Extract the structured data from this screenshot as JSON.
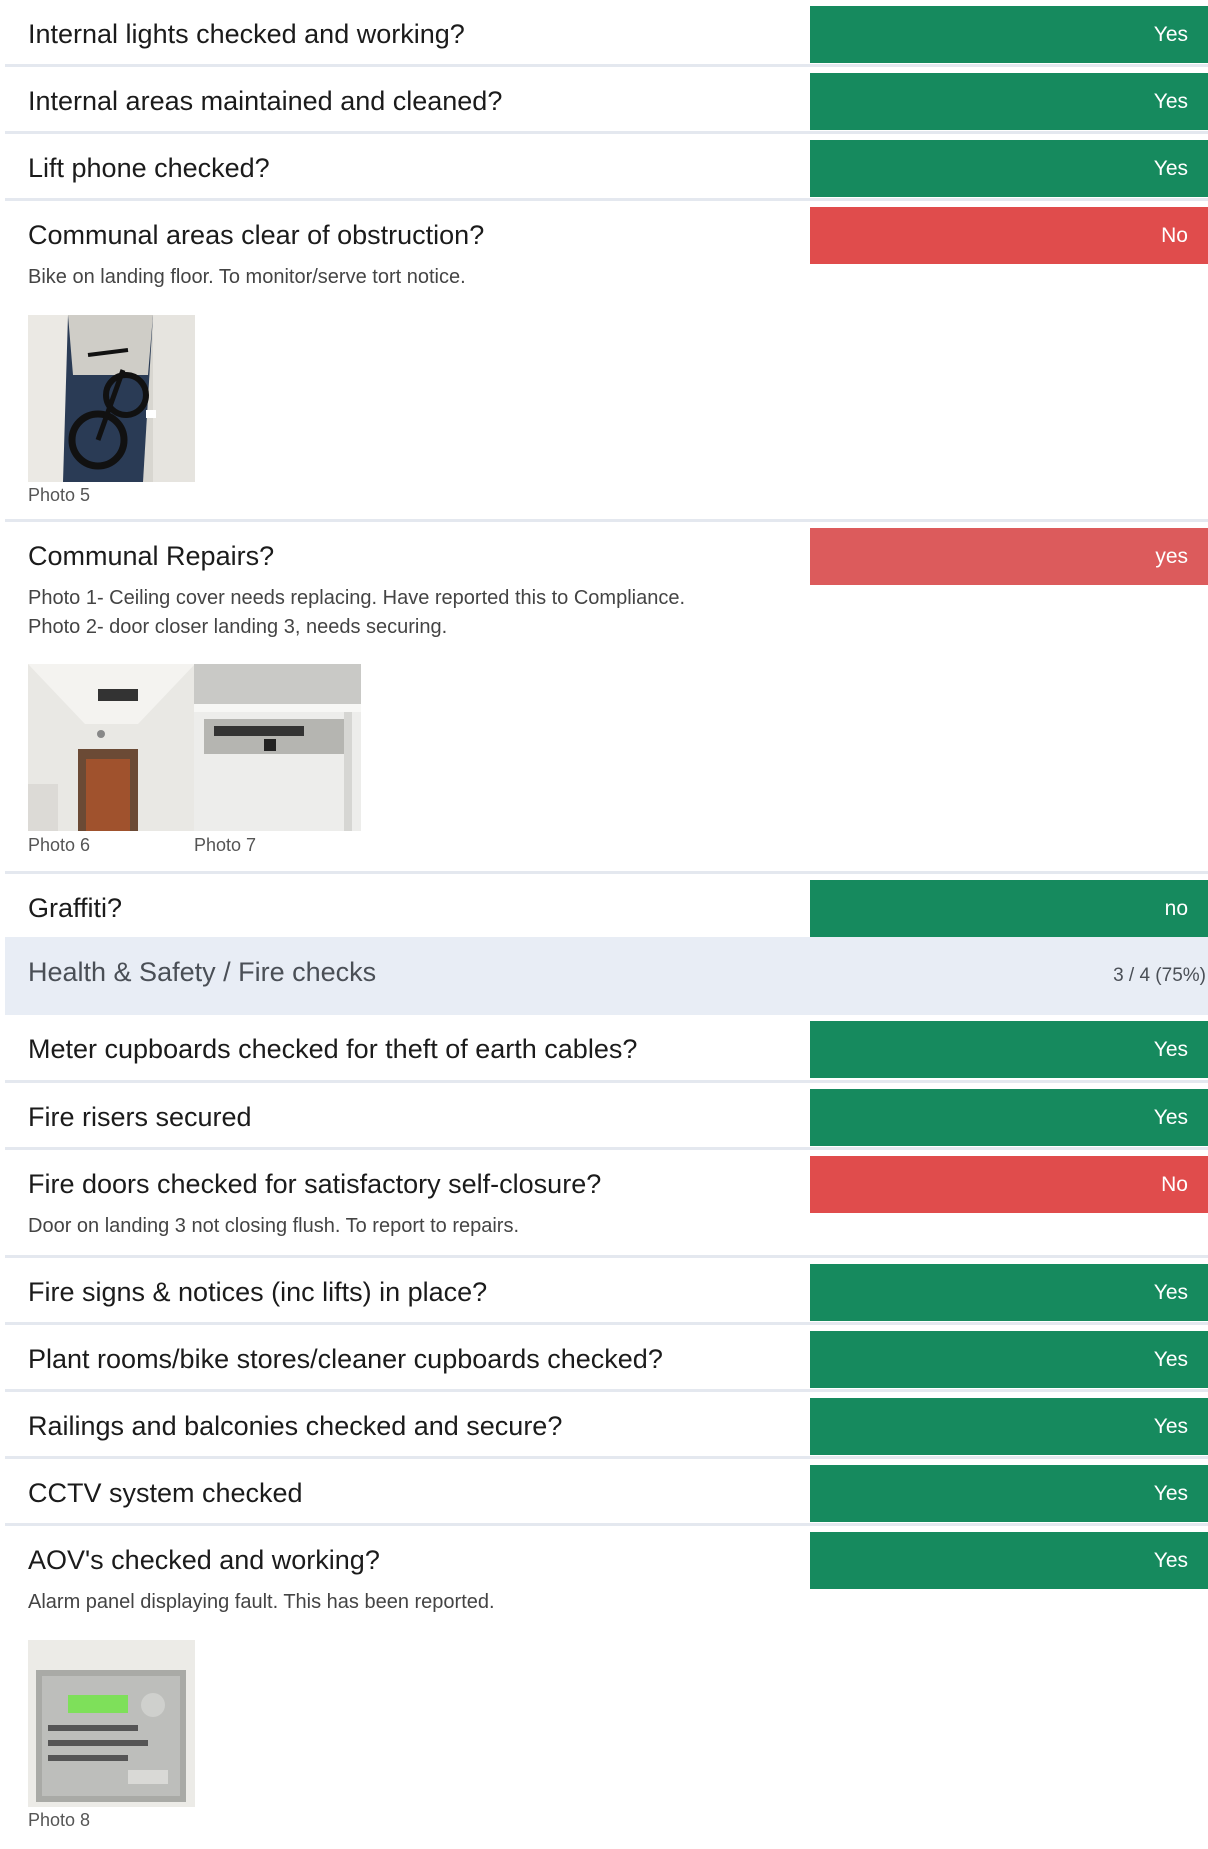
{
  "items_a": [
    {
      "question": "Internal lights checked and working?",
      "answer": "Yes"
    },
    {
      "question": "Internal areas maintained and cleaned?",
      "answer": "Yes"
    },
    {
      "question": "Lift phone checked?",
      "answer": "Yes"
    },
    {
      "question": "Communal areas clear of obstruction?",
      "answer": "No",
      "note": "Bike on landing floor.  To monitor/serve tort notice.",
      "photos": [
        "Photo 5"
      ]
    },
    {
      "question": "Communal Repairs?",
      "answer": "yes",
      "note": "Photo 1- Ceiling cover needs replacing. Have reported this to Compliance.\nPhoto 2- door closer landing 3, needs securing.",
      "photos": [
        "Photo 6",
        "Photo 7"
      ]
    },
    {
      "question": "Graffiti?",
      "answer": "no"
    }
  ],
  "section": {
    "title": "Health & Safety / Fire checks",
    "score": "3 / 4 (75%)"
  },
  "items_b": [
    {
      "question": "Meter cupboards checked for theft of earth cables?",
      "answer": "Yes"
    },
    {
      "question": "Fire risers secured",
      "answer": "Yes"
    },
    {
      "question": "Fire doors checked for satisfactory self-closure?",
      "answer": "No",
      "note": "Door on landing 3 not closing flush.  To report to repairs."
    },
    {
      "question": "Fire signs & notices (inc lifts) in place?",
      "answer": "Yes"
    },
    {
      "question": "Plant rooms/bike stores/cleaner cupboards checked?",
      "answer": "Yes"
    },
    {
      "question": "Railings and balconies checked and secure?",
      "answer": "Yes"
    },
    {
      "question": "CCTV system checked",
      "answer": "Yes"
    },
    {
      "question": "AOV's checked and working?",
      "answer": "Yes",
      "note": "Alarm panel displaying fault. This has been reported.",
      "photos": [
        "Photo 8"
      ]
    }
  ],
  "colors": {
    "pass": "#168a5e",
    "fail": "#e04c4c",
    "fail_alt": "#dc5b5c",
    "section_bg": "#e8edf5"
  }
}
